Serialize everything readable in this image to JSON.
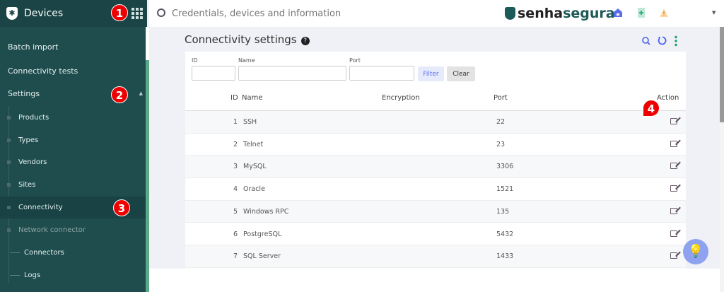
{
  "sidebar": {
    "title": "Devices",
    "items": [
      {
        "label": "Batch import"
      },
      {
        "label": "Connectivity tests"
      },
      {
        "label": "Settings"
      },
      {
        "label": "Products"
      },
      {
        "label": "Types"
      },
      {
        "label": "Vendors"
      },
      {
        "label": "Sites"
      },
      {
        "label": "Connectivity"
      },
      {
        "label": "Network connector"
      },
      {
        "label": "Connectors"
      },
      {
        "label": "Logs"
      }
    ]
  },
  "topbar": {
    "search_placeholder": "Credentials, devices and information",
    "brand_a": "senha",
    "brand_b": "segura"
  },
  "page": {
    "title": "Connectivity settings",
    "help": "?"
  },
  "filters": {
    "id_label": "ID",
    "name_label": "Name",
    "port_label": "Port",
    "filter_btn": "Filter",
    "clear_btn": "Clear"
  },
  "table": {
    "headers": {
      "id": "ID",
      "name": "Name",
      "encryption": "Encryption",
      "port": "Port",
      "action": "Action"
    },
    "rows": [
      {
        "id": "1",
        "name": "SSH",
        "encryption": "",
        "port": "22"
      },
      {
        "id": "2",
        "name": "Telnet",
        "encryption": "",
        "port": "23"
      },
      {
        "id": "3",
        "name": "MySQL",
        "encryption": "",
        "port": "3306"
      },
      {
        "id": "4",
        "name": "Oracle",
        "encryption": "",
        "port": "1521"
      },
      {
        "id": "5",
        "name": "Windows RPC",
        "encryption": "",
        "port": "135"
      },
      {
        "id": "6",
        "name": "PostgreSQL",
        "encryption": "",
        "port": "5432"
      },
      {
        "id": "7",
        "name": "SQL Server",
        "encryption": "",
        "port": "1433"
      }
    ]
  },
  "annotations": [
    "1",
    "2",
    "3",
    "4"
  ],
  "colors": {
    "sidebar": "#1f4d4e",
    "accent": "#5aa887",
    "brand": "#1c5a57",
    "badge": "#e00000"
  }
}
